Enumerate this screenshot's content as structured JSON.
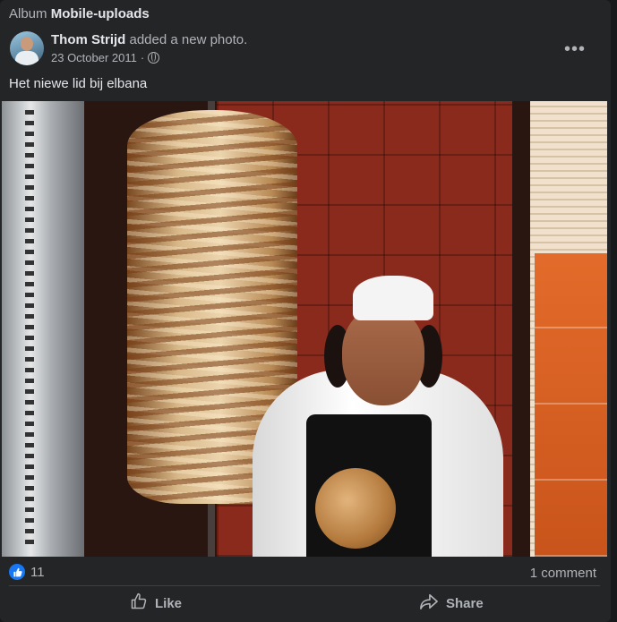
{
  "album": {
    "prefix": "Album",
    "name": "Mobile-uploads"
  },
  "post": {
    "author": "Thom Strijd",
    "action": "added a new photo.",
    "date": "23 October 2011",
    "separator": "·",
    "caption": "Het niewe lid bij elbana",
    "more_icon": "more-horizontal-icon",
    "privacy_icon": "globe-icon"
  },
  "stats": {
    "reaction_icon": "like-thumb-icon",
    "reaction_count": "11",
    "comments": "1 comment"
  },
  "actions": {
    "like_label": "Like",
    "share_label": "Share"
  },
  "colors": {
    "background": "#242526",
    "text_primary": "#e4e6eb",
    "text_secondary": "#b0b3b8",
    "like_blue": "#1877f2"
  }
}
